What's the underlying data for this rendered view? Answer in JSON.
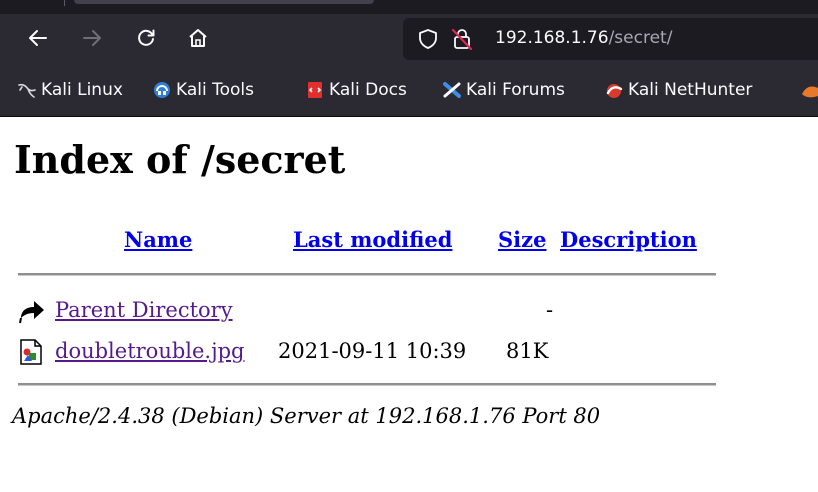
{
  "browser": {
    "url_host": "192.168.1.76",
    "url_path": "/secret/",
    "bookmarks": [
      {
        "label": "Kali Linux",
        "icon": "kali-dragon-icon"
      },
      {
        "label": "Kali Tools",
        "icon": "kali-tools-icon"
      },
      {
        "label": "Kali Docs",
        "icon": "kali-docs-icon"
      },
      {
        "label": "Kali Forums",
        "icon": "kali-forums-icon"
      },
      {
        "label": "Kali NetHunter",
        "icon": "kali-nethunter-icon"
      }
    ],
    "colors": {
      "toolbar": "#2b2a33",
      "urlbar": "#1c1b22",
      "text": "#fbfbfe"
    }
  },
  "page": {
    "title": "Index of /secret",
    "columns": {
      "name": "Name",
      "last_modified": "Last modified",
      "size": "Size",
      "description": "Description"
    },
    "rows": [
      {
        "name": "Parent Directory",
        "modified": "",
        "size": "-",
        "description": "",
        "icon": "back-icon"
      },
      {
        "name": "doubletrouble.jpg",
        "modified": "2021-09-11 10:39",
        "size": "81K",
        "description": "",
        "icon": "image-file-icon"
      }
    ],
    "footer": "Apache/2.4.38 (Debian) Server at 192.168.1.76 Port 80",
    "colors": {
      "link": "#0000ee",
      "visited": "#551a8b"
    }
  }
}
